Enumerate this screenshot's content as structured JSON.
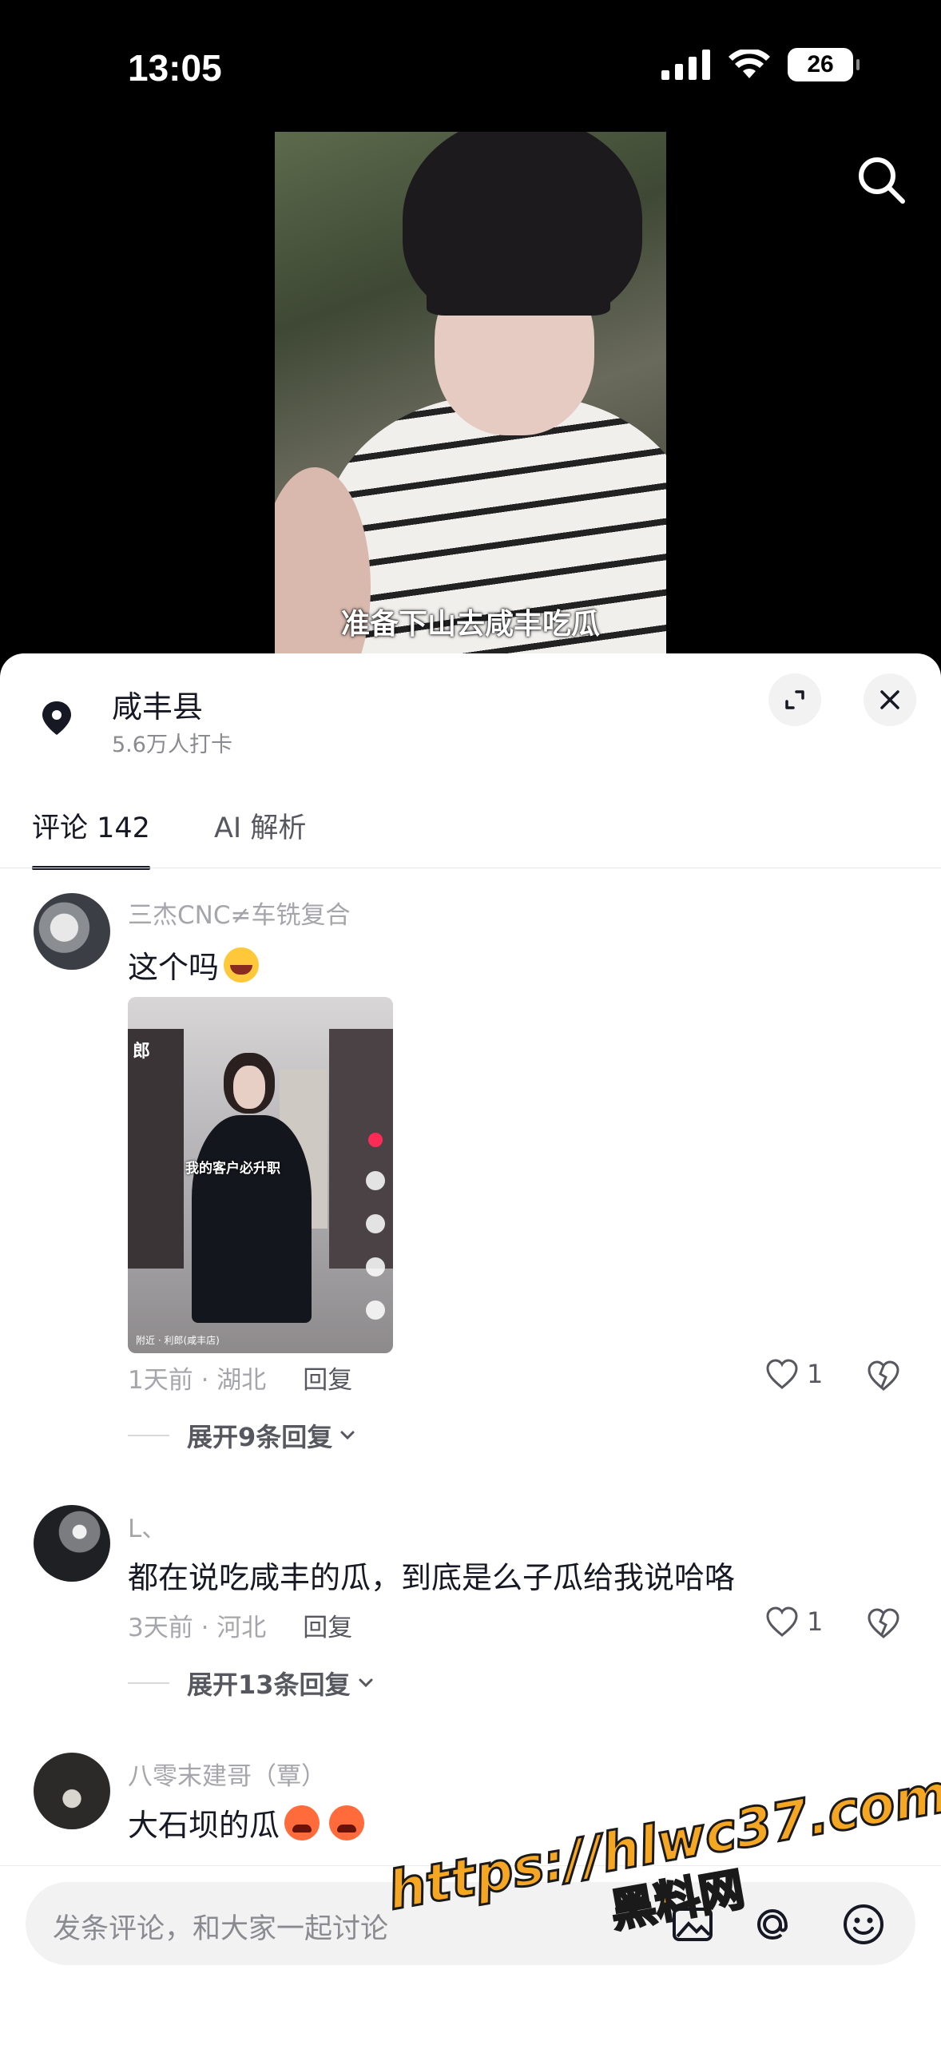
{
  "status": {
    "time": "13:05",
    "battery": "26"
  },
  "video": {
    "caption": "准备下山去咸丰吃瓜"
  },
  "location": {
    "name": "咸丰县",
    "checkins": "5.6万人打卡"
  },
  "tabs": [
    {
      "label": "评论 142"
    },
    {
      "label": "AI 解析"
    }
  ],
  "comments": [
    {
      "user": "三杰CNC≠车铣复合",
      "text": "这个吗",
      "emojis": [
        "laugh-emoji"
      ],
      "attachment": {
        "caption": "我的客户必升职",
        "location": "附近 · 利郎(咸丰店)",
        "corner_text": "郎"
      },
      "meta": "1天前 · 湖北",
      "reply_label": "回复",
      "likes": "1",
      "expand": "展开9条回复"
    },
    {
      "user": "L、",
      "text": "都在说吃咸丰的瓜，到底是么子瓜给我说哈咯",
      "meta": "3天前 · 河北",
      "reply_label": "回复",
      "likes": "1",
      "expand": "展开13条回复"
    },
    {
      "user": "八零末建哥（覃）",
      "text": "大石坝的瓜",
      "emojis": [
        "angry-emoji",
        "angry-emoji"
      ]
    }
  ],
  "input": {
    "placeholder": "发条评论，和大家一起讨论"
  },
  "watermark": {
    "url": "https://hlwc37.com",
    "name": "黑料网"
  }
}
